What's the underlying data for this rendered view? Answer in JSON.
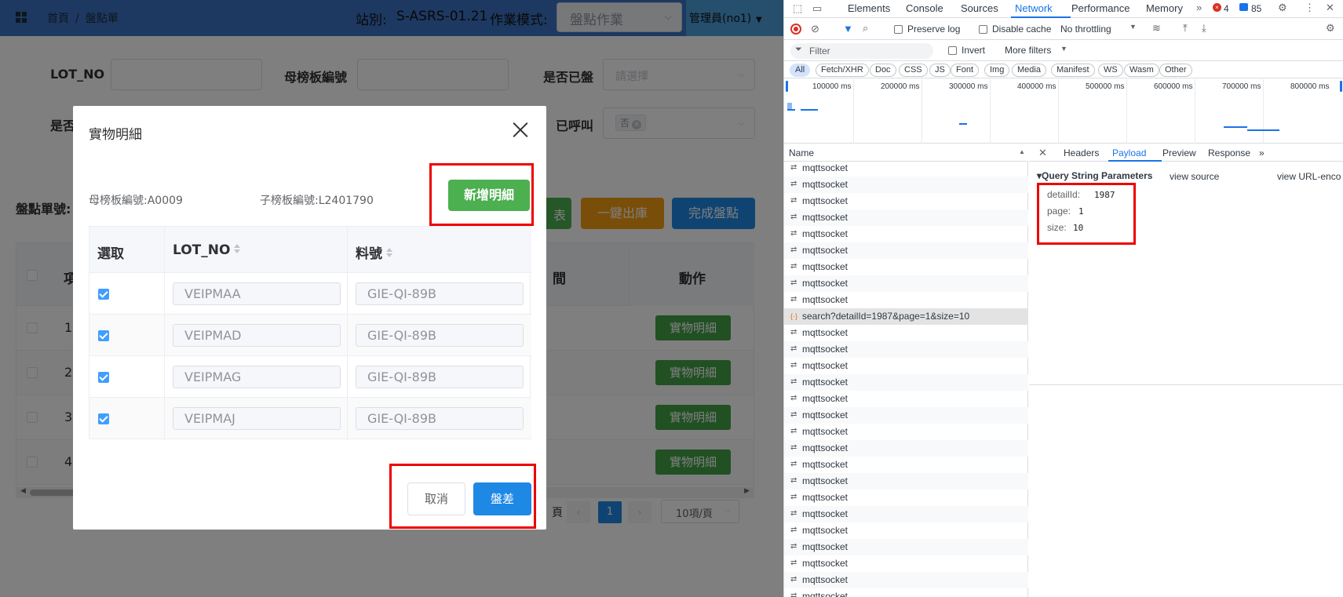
{
  "app": {
    "breadcrumb": {
      "home": "首頁",
      "sep": "/",
      "current": "盤點單"
    },
    "station_label": "站別:",
    "station_value": "S-ASRS-01.21",
    "mode_label": "作業模式:",
    "mode_value": "盤點作業",
    "user": "管理員(no1)",
    "filters": {
      "lot_no_label": "LOT_NO",
      "mother_board_label": "母榜板編號",
      "counted_label": "是否已盤",
      "counted_placeholder": "請選擇",
      "row2_label_partial": "是否",
      "called_label": "已呼叫",
      "called_tag": "否"
    },
    "list_label_partial": "盤點單號:",
    "buttons": {
      "report_partial": "表",
      "one_click_out": "一鍵出庫",
      "finish_count": "完成盤點"
    },
    "table": {
      "head_item_partial": "項",
      "head_period_partial": "間",
      "head_action": "動作",
      "rows": [
        {
          "num": "1",
          "action": "實物明細"
        },
        {
          "num": "2",
          "action": "實物明細"
        },
        {
          "num": "3",
          "action": "實物明細"
        },
        {
          "num": "4",
          "action": "實物明細"
        }
      ]
    },
    "pagination": {
      "page_suffix": "頁",
      "current": "1",
      "page_size": "10項/頁"
    }
  },
  "modal": {
    "title": "實物明細",
    "mother_board": "母榜板編號:A0009",
    "child_board": "子榜板編號:L2401790",
    "add_button": "新增明細",
    "headers": {
      "select": "選取",
      "lot_no": "LOT_NO",
      "part_no": "料號"
    },
    "rows": [
      {
        "checked": true,
        "lot_no": "VEIPMAA",
        "part_no": "GIE-QI-89B"
      },
      {
        "checked": true,
        "lot_no": "VEIPMAD",
        "part_no": "GIE-QI-89B"
      },
      {
        "checked": true,
        "lot_no": "VEIPMAG",
        "part_no": "GIE-QI-89B"
      },
      {
        "checked": true,
        "lot_no": "VEIPMAJ",
        "part_no": "GIE-QI-89B"
      }
    ],
    "cancel": "取消",
    "confirm": "盤差"
  },
  "devtools": {
    "tabs": [
      "Elements",
      "Console",
      "Sources",
      "Network",
      "Performance",
      "Memory"
    ],
    "active_tab": "Network",
    "error_count": "4",
    "message_count": "85",
    "toolbar": {
      "preserve_log": "Preserve log",
      "disable_cache": "Disable cache",
      "throttling": "No throttling"
    },
    "filter_placeholder": "Filter",
    "invert": "Invert",
    "more_filters": "More filters",
    "type_filters": [
      "All",
      "Fetch/XHR",
      "Doc",
      "CSS",
      "JS",
      "Font",
      "Img",
      "Media",
      "Manifest",
      "WS",
      "Wasm",
      "Other"
    ],
    "timeline_labels": [
      "100000 ms",
      "200000 ms",
      "300000 ms",
      "400000 ms",
      "500000 ms",
      "600000 ms",
      "700000 ms",
      "800000 ms"
    ],
    "name_header": "Name",
    "requests_top": [
      "mqttsocket",
      "mqttsocket",
      "mqttsocket",
      "mqttsocket",
      "mqttsocket",
      "mqttsocket",
      "mqttsocket",
      "mqttsocket",
      "mqttsocket"
    ],
    "selected_request": "search?detailId=1987&page=1&size=10",
    "requests_bottom": [
      "mqttsocket",
      "mqttsocket",
      "mqttsocket",
      "mqttsocket",
      "mqttsocket",
      "mqttsocket",
      "mqttsocket",
      "mqttsocket",
      "mqttsocket",
      "mqttsocket",
      "mqttsocket",
      "mqttsocket",
      "mqttsocket",
      "mqttsocket",
      "mqttsocket",
      "mqttsocket",
      "mqttsocket"
    ],
    "detail_tabs": [
      "Headers",
      "Payload",
      "Preview",
      "Response"
    ],
    "active_detail_tab": "Payload",
    "qsp_title": "▾Query String Parameters",
    "view_source": "view source",
    "view_url_encoded": "view URL-enco",
    "params": [
      {
        "key": "detailId:",
        "value": "1987"
      },
      {
        "key": "page:",
        "value": "1"
      },
      {
        "key": "size:",
        "value": "10"
      }
    ]
  }
}
